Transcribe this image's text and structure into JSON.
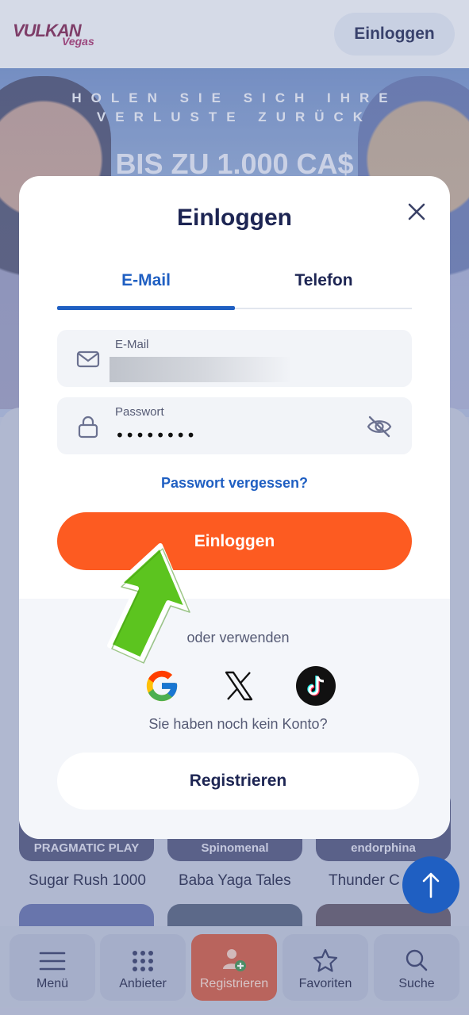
{
  "header": {
    "logo_text_main": "VULKAN",
    "logo_text_sub": "Vegas",
    "login_label": "Einloggen"
  },
  "banner": {
    "promo_line": "HOLEN SIE SICH IHRE VERLUSTE ZURÜCK",
    "promo_amount": "BIS ZU 1.000 CA$"
  },
  "games": [
    {
      "provider": "PRAGMATIC PLAY",
      "name": "Sugar Rush 1000"
    },
    {
      "provider": "Spinomenal",
      "name": "Baba Yaga Tales"
    },
    {
      "provider": "endorphina",
      "name": "Thunder C"
    }
  ],
  "bottom_nav": {
    "menu": "Menü",
    "providers": "Anbieter",
    "register": "Registrieren",
    "favorites": "Favoriten",
    "search": "Suche"
  },
  "modal": {
    "title": "Einloggen",
    "tabs": {
      "email": "E-Mail",
      "phone": "Telefon"
    },
    "email_label": "E-Mail",
    "password_label": "Passwort",
    "password_value": "••••••••",
    "forgot_label": "Passwort vergessen?",
    "login_label": "Einloggen",
    "or_use": "oder verwenden",
    "no_account": "Sie haben noch kein Konto?",
    "register_label": "Registrieren"
  },
  "colors": {
    "accent_orange": "#fd5b21",
    "accent_blue": "#1f5fc2",
    "navy": "#1d2553"
  },
  "icons": [
    "mail-icon",
    "lock-icon",
    "eye-off-icon",
    "close-icon",
    "google-icon",
    "x-icon",
    "tiktok-icon",
    "menu-icon",
    "grid-icon",
    "user-plus-icon",
    "star-icon",
    "search-icon",
    "arrow-up-icon"
  ]
}
